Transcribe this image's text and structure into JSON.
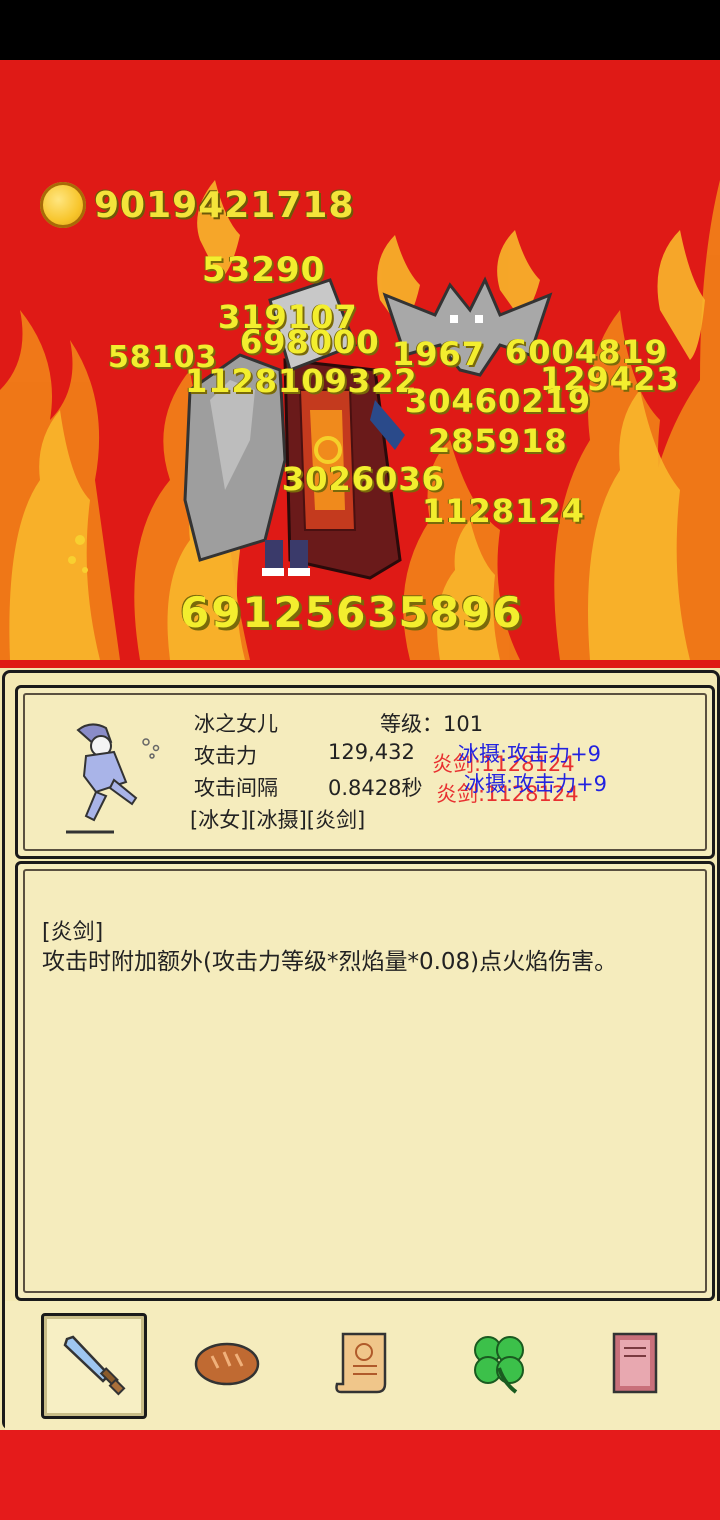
{
  "gold": {
    "icon": "gold-coin-icon",
    "amount": "9019421718"
  },
  "damage_numbers": [
    {
      "text": "53290"
    },
    {
      "text": "319107"
    },
    {
      "text": "698000"
    },
    {
      "text": "58103"
    },
    {
      "text": "1128109322"
    },
    {
      "text": "1967"
    },
    {
      "text": "6004819"
    },
    {
      "text": "129423"
    },
    {
      "text": "30460219"
    },
    {
      "text": "285918"
    },
    {
      "text": "3026036"
    },
    {
      "text": "1128124"
    }
  ],
  "total_damage": "69125635896",
  "hero": {
    "name": "冰之女儿",
    "level_label": "等级：101",
    "attack_label": "攻击力",
    "attack_value": "129,432",
    "interval_label": "攻击间隔",
    "interval_value": "0.8428秒",
    "tags": "[冰女][冰摄][炎剑]",
    "buff_1": "冰摄:攻击力+9",
    "buff_2": "冰摄:攻击力+9",
    "fire_1": "炎剑:1128124",
    "fire_2": "炎剑:1128124"
  },
  "description": {
    "title": "[炎剑]",
    "text": "攻击时附加额外(攻击力等级*烈焰量*0.08)点火焰伤害。"
  },
  "tabs": [
    {
      "icon": "sword-icon",
      "active": true
    },
    {
      "icon": "bread-icon",
      "active": false
    },
    {
      "icon": "scroll-icon",
      "active": false
    },
    {
      "icon": "clover-icon",
      "active": false
    },
    {
      "icon": "book-icon",
      "active": false
    }
  ],
  "colors": {
    "background_red": "#e01818",
    "damage_yellow": "#f3ee2e",
    "panel_parchment": "#f5ecbd",
    "buff_blue": "#2323e0",
    "fire_red": "#e83030"
  }
}
